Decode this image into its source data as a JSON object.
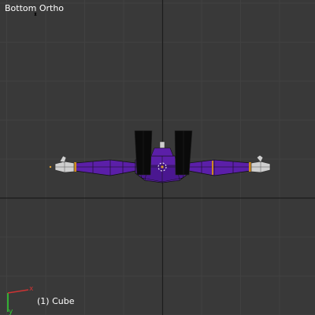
{
  "viewport": {
    "view_name": "Bottom Ortho",
    "active_object_label": "(1) Cube",
    "background_color": "#393939",
    "grid_color": "#414141",
    "axis_x_color": "#1a1a1a",
    "axis_y_color": "#1a1a1a"
  },
  "model": {
    "name": "Cube",
    "body_color": "#5b1fa8",
    "body_dark_color": "#3b0f7a",
    "wire_color": "#000000",
    "boot_color": "#0a0a0a",
    "hand_color": "#cfcfcf",
    "band_color": "#d08a20"
  },
  "gizmo": {
    "x_label": "x",
    "y_label": "y",
    "x_color": "#cc3333",
    "y_color": "#33cc33"
  }
}
